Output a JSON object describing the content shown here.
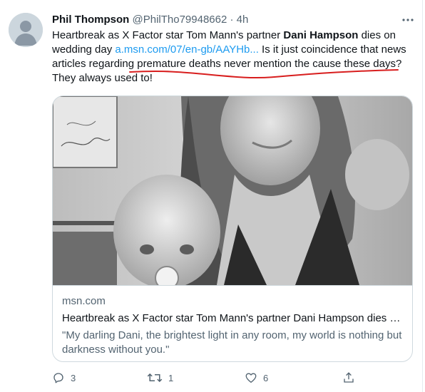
{
  "tweet": {
    "author_name": "Phil Thompson",
    "author_handle": "@PhilTho79948662",
    "separator": "·",
    "time": "4h",
    "text_before_bold": "Heartbreak as X Factor star Tom Mann's partner ",
    "text_bold": "Dani Hampson",
    "text_after_bold": " dies on wedding day ",
    "link_text": "a.msn.com/07/en-gb/AAYHb...",
    "text_after_link": " Is it just coincidence that news articles regarding premature deaths never mention the cause these days? They always used to!"
  },
  "card": {
    "domain": "msn.com",
    "title": "Heartbreak as X Factor star Tom Mann's partner Dani Hampson dies o...",
    "description": "\"My darling Dani, the brightest light in any room, my world is nothing but darkness without you.\""
  },
  "actions": {
    "reply_count": "3",
    "retweet_count": "1",
    "like_count": "6"
  },
  "icons": {
    "more": "more-icon",
    "reply": "reply-icon",
    "retweet": "retweet-icon",
    "like": "like-icon",
    "share": "share-icon"
  },
  "colors": {
    "link": "#1d9bf0",
    "secondary_text": "#536471",
    "annotation": "#d81e1e"
  }
}
